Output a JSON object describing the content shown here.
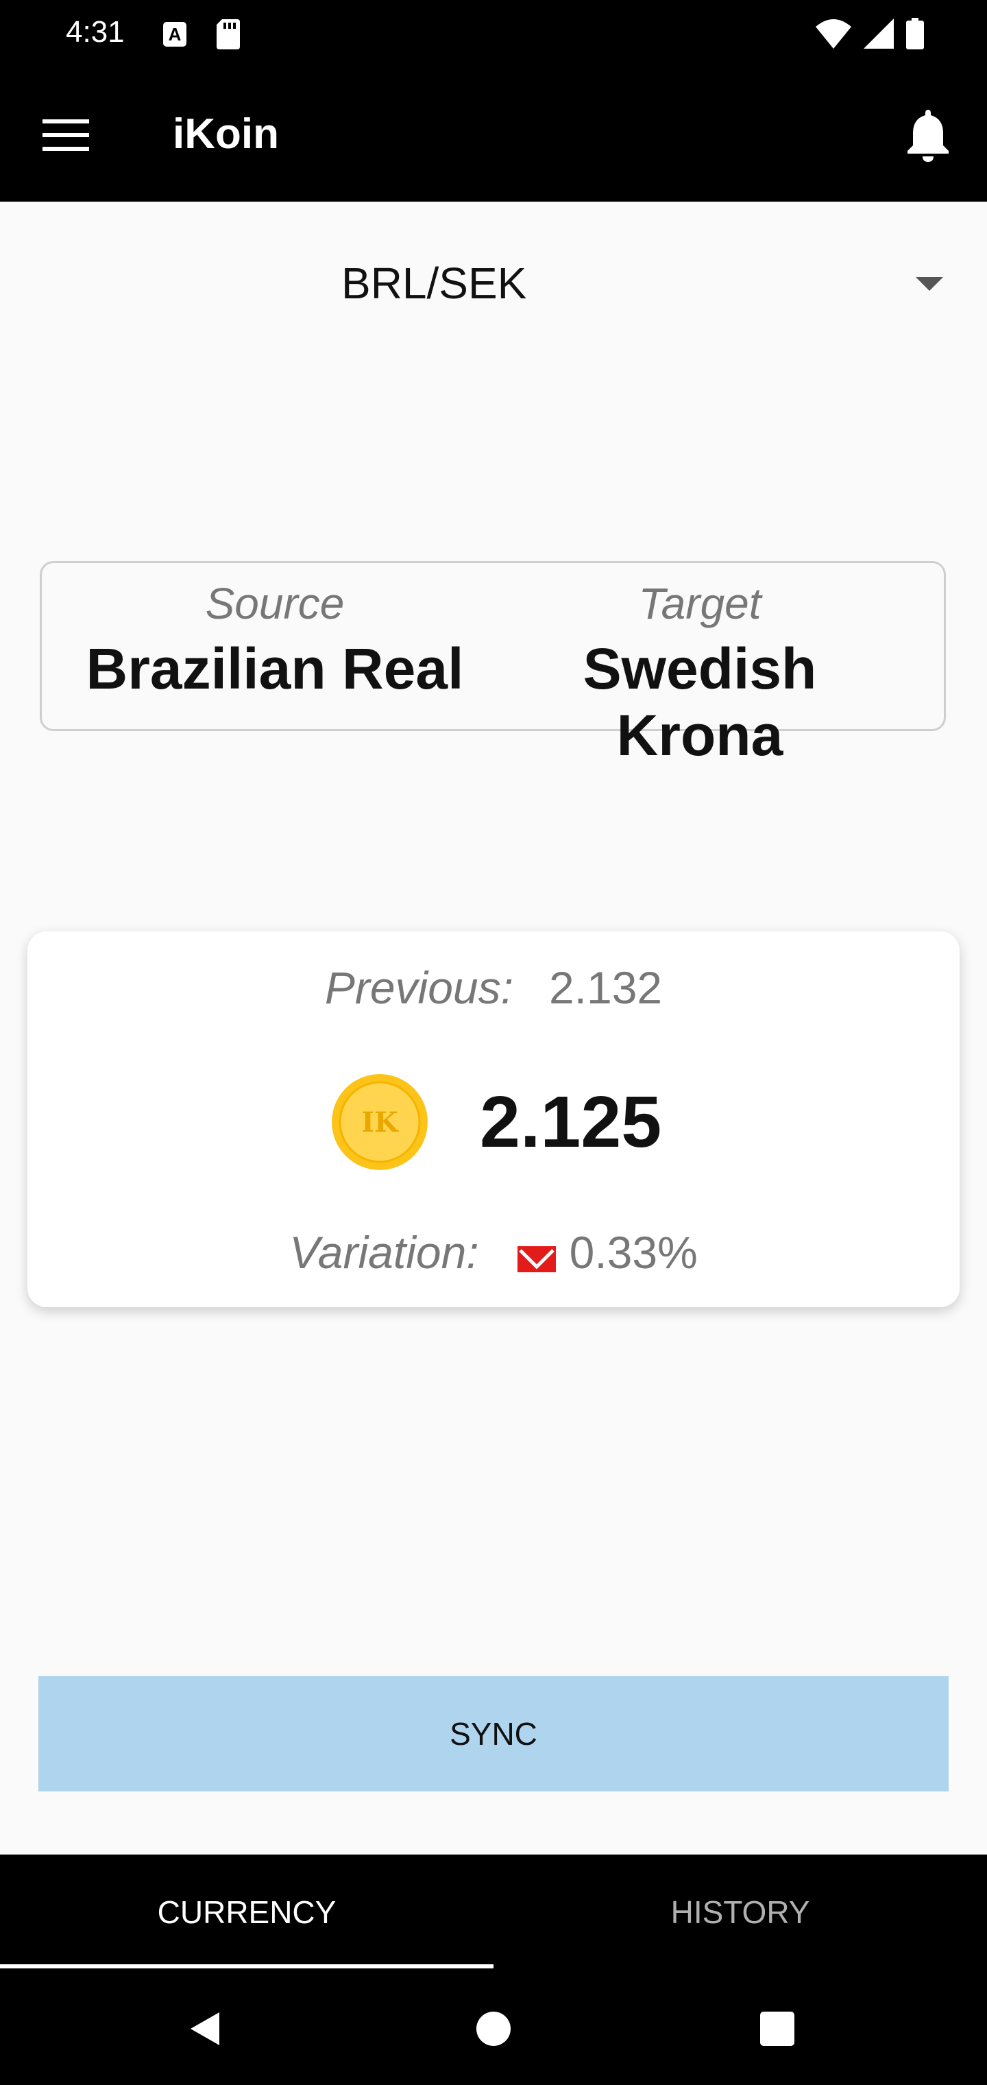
{
  "status_bar": {
    "time": "4:31",
    "notification_icon_letter": "A",
    "icons": [
      "a-notification-icon",
      "sd-card-icon",
      "wifi-icon",
      "signal-icon",
      "battery-icon"
    ]
  },
  "app_bar": {
    "title": "iKoin",
    "icons": [
      "menu-icon",
      "bell-icon"
    ]
  },
  "pair_selector": {
    "value": "BRL/SEK"
  },
  "pair_info": {
    "source_label": "Source",
    "source_name": "Brazilian Real",
    "target_label": "Target",
    "target_name": "Swedish Krona"
  },
  "rate_card": {
    "previous_label": "Previous:",
    "previous_value": "2.132",
    "coin_text": "IK",
    "current_value": "2.125",
    "variation_label": "Variation:",
    "variation_value": "0.33%",
    "variation_direction": "down"
  },
  "sync_button": {
    "label": "SYNC"
  },
  "bottom_tabs": {
    "tabs": [
      {
        "label": "CURRENCY",
        "selected": true
      },
      {
        "label": "HISTORY",
        "selected": false
      }
    ]
  },
  "colors": {
    "bar_background": "#000000",
    "content_background": "#fafafa",
    "sync_button": "#aed4ee",
    "coin_gold": "#fcc419",
    "variation_down": "#e31b1b"
  }
}
